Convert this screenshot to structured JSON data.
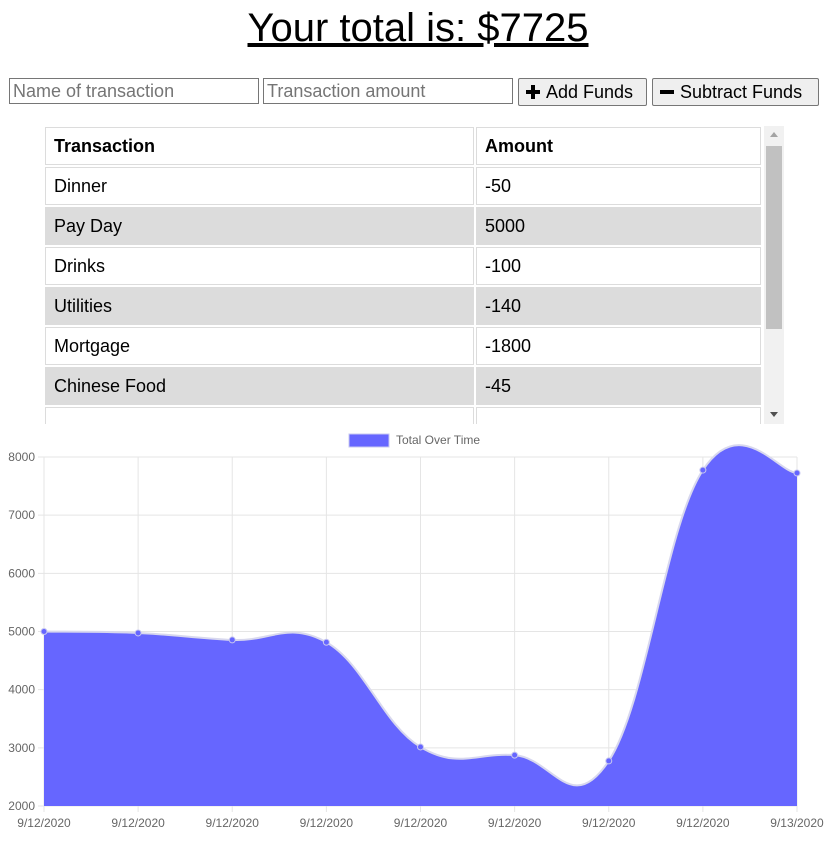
{
  "header": {
    "total_label": "Your total is: $7725"
  },
  "form": {
    "name_placeholder": "Name of transaction",
    "amount_placeholder": "Transaction amount",
    "add_label": "Add Funds",
    "subtract_label": "Subtract Funds"
  },
  "table": {
    "headers": [
      "Transaction",
      "Amount"
    ],
    "rows": [
      [
        "Dinner",
        "-50"
      ],
      [
        "Pay Day",
        "5000"
      ],
      [
        "Drinks",
        "-100"
      ],
      [
        "Utilities",
        "-140"
      ],
      [
        "Mortgage",
        "-1800"
      ],
      [
        "Chinese Food",
        "-45"
      ],
      [
        "",
        ""
      ]
    ]
  },
  "colors": {
    "series_fill": "#6666ff",
    "series_stroke": "#6666ff",
    "grid": "#e5e5e5",
    "row_shade": "#dcdcdc"
  },
  "chart_data": {
    "type": "area",
    "title": "",
    "legend_position": "top",
    "grid": true,
    "x": [
      "9/12/2020",
      "9/12/2020",
      "9/12/2020",
      "9/12/2020",
      "9/12/2020",
      "9/12/2020",
      "9/12/2020",
      "9/12/2020",
      "9/13/2020"
    ],
    "series": [
      {
        "name": "Total Over Time",
        "values": [
          5000,
          4975,
          4855,
          4815,
          3015,
          2875,
          2775,
          7775,
          7725
        ]
      }
    ],
    "ylim": [
      2000,
      8000
    ],
    "yticks": [
      2000,
      3000,
      4000,
      5000,
      6000,
      7000,
      8000
    ]
  }
}
